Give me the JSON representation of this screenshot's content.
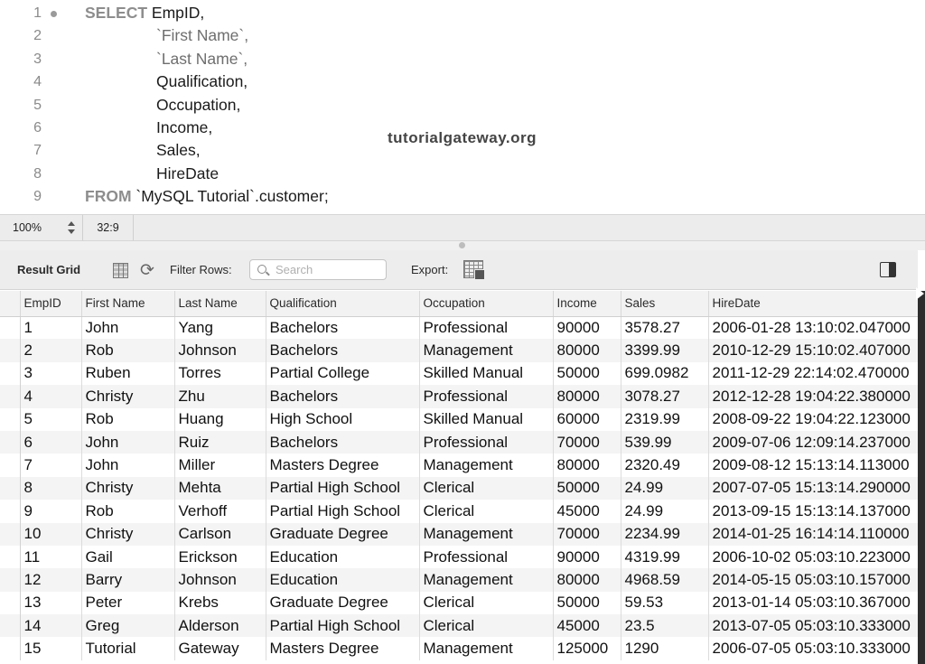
{
  "editor": {
    "lines": [
      {
        "num": "1",
        "kw": "SELECT",
        "text": " EmpID,",
        "indent": false,
        "quoted": false
      },
      {
        "num": "2",
        "kw": "",
        "text": "`First Name`,",
        "indent": true,
        "quoted": true
      },
      {
        "num": "3",
        "kw": "",
        "text": "`Last Name`,",
        "indent": true,
        "quoted": true
      },
      {
        "num": "4",
        "kw": "",
        "text": "Qualification,",
        "indent": true,
        "quoted": false
      },
      {
        "num": "5",
        "kw": "",
        "text": "Occupation,",
        "indent": true,
        "quoted": false
      },
      {
        "num": "6",
        "kw": "",
        "text": "Income,",
        "indent": true,
        "quoted": false
      },
      {
        "num": "7",
        "kw": "",
        "text": "Sales,",
        "indent": true,
        "quoted": false
      },
      {
        "num": "8",
        "kw": "",
        "text": "HireDate",
        "indent": true,
        "quoted": false
      },
      {
        "num": "9",
        "kw": "FROM",
        "text": " `MySQL Tutorial`.customer;",
        "indent": false,
        "quoted": false
      }
    ],
    "watermark": "tutorialgateway.org"
  },
  "status": {
    "zoom": "100%",
    "cursor": "32:9"
  },
  "toolbar": {
    "title": "Result Grid",
    "filter_label": "Filter Rows:",
    "search_placeholder": "Search",
    "export_label": "Export:"
  },
  "grid": {
    "columns": [
      "EmpID",
      "First Name",
      "Last Name",
      "Qualification",
      "Occupation",
      "Income",
      "Sales",
      "HireDate"
    ],
    "rows": [
      [
        "1",
        "John",
        "Yang",
        "Bachelors",
        "Professional",
        "90000",
        "3578.27",
        "2006-01-28 13:10:02.047000"
      ],
      [
        "2",
        "Rob",
        "Johnson",
        "Bachelors",
        "Management",
        "80000",
        "3399.99",
        "2010-12-29 15:10:02.407000"
      ],
      [
        "3",
        "Ruben",
        "Torres",
        "Partial College",
        "Skilled Manual",
        "50000",
        "699.0982",
        "2011-12-29 22:14:02.470000"
      ],
      [
        "4",
        "Christy",
        "Zhu",
        "Bachelors",
        "Professional",
        "80000",
        "3078.27",
        "2012-12-28 19:04:22.380000"
      ],
      [
        "5",
        "Rob",
        "Huang",
        "High School",
        "Skilled Manual",
        "60000",
        "2319.99",
        "2008-09-22 19:04:22.123000"
      ],
      [
        "6",
        "John",
        "Ruiz",
        "Bachelors",
        "Professional",
        "70000",
        "539.99",
        "2009-07-06 12:09:14.237000"
      ],
      [
        "7",
        "John",
        "Miller",
        "Masters Degree",
        "Management",
        "80000",
        "2320.49",
        "2009-08-12 15:13:14.113000"
      ],
      [
        "8",
        "Christy",
        "Mehta",
        "Partial High School",
        "Clerical",
        "50000",
        "24.99",
        "2007-07-05 15:13:14.290000"
      ],
      [
        "9",
        "Rob",
        "Verhoff",
        "Partial High School",
        "Clerical",
        "45000",
        "24.99",
        "2013-09-15 15:13:14.137000"
      ],
      [
        "10",
        "Christy",
        "Carlson",
        "Graduate Degree",
        "Management",
        "70000",
        "2234.99",
        "2014-01-25 16:14:14.110000"
      ],
      [
        "11",
        "Gail",
        "Erickson",
        "Education",
        "Professional",
        "90000",
        "4319.99",
        "2006-10-02 05:03:10.223000"
      ],
      [
        "12",
        "Barry",
        "Johnson",
        "Education",
        "Management",
        "80000",
        "4968.59",
        "2014-05-15 05:03:10.157000"
      ],
      [
        "13",
        "Peter",
        "Krebs",
        "Graduate Degree",
        "Clerical",
        "50000",
        "59.53",
        "2013-01-14 05:03:10.367000"
      ],
      [
        "14",
        "Greg",
        "Alderson",
        "Partial High School",
        "Clerical",
        "45000",
        "23.5",
        "2013-07-05 05:03:10.333000"
      ],
      [
        "15",
        "Tutorial",
        "Gateway",
        "Masters Degree",
        "Management",
        "125000",
        "1290",
        "2006-07-05 05:03:10.333000"
      ]
    ]
  }
}
